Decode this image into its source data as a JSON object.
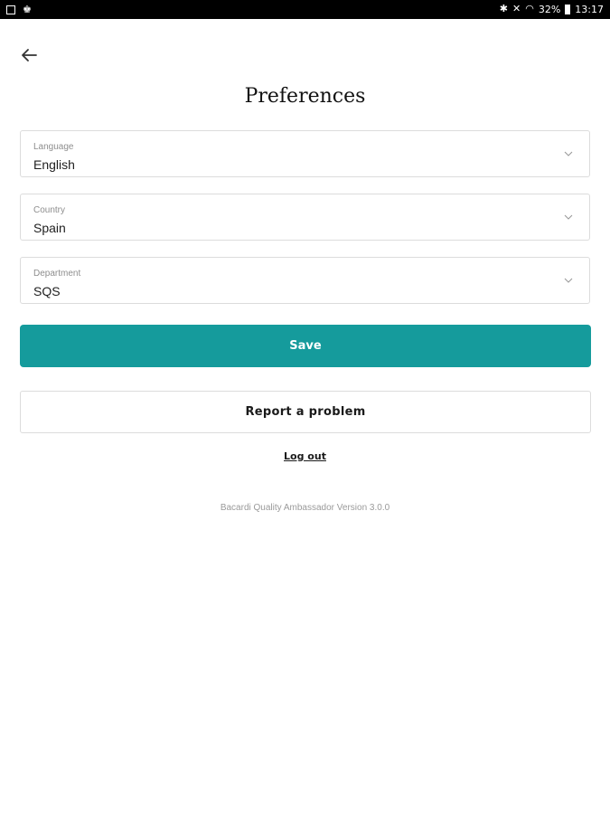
{
  "status_bar": {
    "battery": "32%",
    "time": "13:17",
    "icons": [
      "gallery-icon",
      "app-notification-icon",
      "bluetooth-icon",
      "mute-icon",
      "wifi-icon",
      "battery-icon"
    ]
  },
  "header": {
    "title": "Preferences",
    "back_icon": "arrow-left-icon"
  },
  "form": {
    "language": {
      "label": "Language",
      "value": "English"
    },
    "country": {
      "label": "Country",
      "value": "Spain"
    },
    "department": {
      "label": "Department",
      "value": "SQS"
    },
    "chevron_icon": "chevron-down-icon"
  },
  "actions": {
    "save_label": "Save",
    "report_label": "Report a problem",
    "logout_label": "Log out"
  },
  "footer": {
    "version": "Bacardi Quality Ambassador Version 3.0.0"
  },
  "colors": {
    "accent": "#159b9c",
    "status_bar": "#000000"
  }
}
